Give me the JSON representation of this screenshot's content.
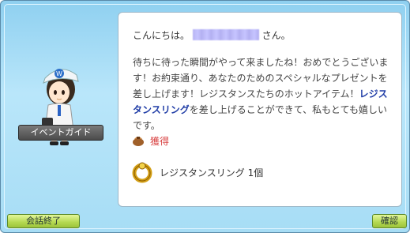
{
  "npc": {
    "nameplate": "イベントガイド",
    "icon": "npc-guide-portrait"
  },
  "panel": {
    "greeting_prefix": "こんにちは。",
    "greeting_suffix": "さん。",
    "message_part1": "待ちに待った瞬間がやって来ましたね！おめでとうございます！お約束通り、あなたのためのスペシャルなプレゼントを差し上げます！レジスタンスたちのホットアイテム！",
    "item_highlight": "レジスタンスリング",
    "message_part2": "を差し上げることができて、私もとても嬉しいです。",
    "reward_label": "獲得",
    "reward_icon": "reward-bag-icon",
    "item_text": "レジスタンスリング 1個",
    "item_icon": "gold-ring-icon"
  },
  "buttons": {
    "end_chat": "会話終了",
    "confirm": "確認"
  }
}
